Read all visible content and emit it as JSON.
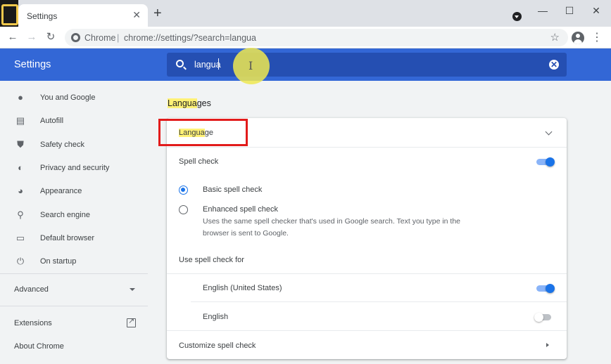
{
  "colors": {
    "accent": "#1a73e8",
    "header": "#3367d6",
    "highlight": "#fff176",
    "annotation": "#e21b1b"
  },
  "browser": {
    "tab_title": "Settings",
    "tab_close": "✕",
    "new_tab": "+",
    "omnibox_site": "Chrome",
    "omnibox_separator": "|",
    "omnibox_url": "chrome://settings/?search=langua",
    "minimize": "—",
    "maximize": "☐",
    "close": "✕",
    "back": "←",
    "forward": "→",
    "reload": "↻",
    "bookmark": "☆",
    "menu": "⋮"
  },
  "header": {
    "title": "Settings",
    "search_value": "langua",
    "search_clear": "✕",
    "cursor": "I"
  },
  "sidebar": {
    "items": [
      {
        "label": "You and Google",
        "icon": "person-icon",
        "glyph": "●"
      },
      {
        "label": "Autofill",
        "icon": "clipboard-icon",
        "glyph": "▤"
      },
      {
        "label": "Safety check",
        "icon": "shield-check-icon",
        "glyph": "⛊"
      },
      {
        "label": "Privacy and security",
        "icon": "shield-icon",
        "glyph": "◐"
      },
      {
        "label": "Appearance",
        "icon": "palette-icon",
        "glyph": "◕"
      },
      {
        "label": "Search engine",
        "icon": "search-icon",
        "glyph": "⚲"
      },
      {
        "label": "Default browser",
        "icon": "browser-icon",
        "glyph": "▭"
      },
      {
        "label": "On startup",
        "icon": "power-icon",
        "glyph": "⏻"
      }
    ],
    "advanced": "Advanced",
    "extensions": "Extensions",
    "about": "About Chrome"
  },
  "main": {
    "section_title_highlight": "Langua",
    "section_title_rest": "ges",
    "language_highlight": "Langua",
    "language_rest": "ge",
    "spell_check": "Spell check",
    "spell_check_on": true,
    "basic_spell_check": "Basic spell check",
    "basic_selected": true,
    "enhanced_spell_check": "Enhanced spell check",
    "enhanced_desc_1": "Uses the same spell checker that's used in Google search. Text you type in the",
    "enhanced_desc_2": "browser is sent to Google.",
    "use_spell_check_for": "Use spell check for",
    "languages": [
      {
        "name": "English (United States)",
        "enabled": true
      },
      {
        "name": "English",
        "enabled": false
      }
    ],
    "customize_spell_check": "Customize spell check"
  }
}
